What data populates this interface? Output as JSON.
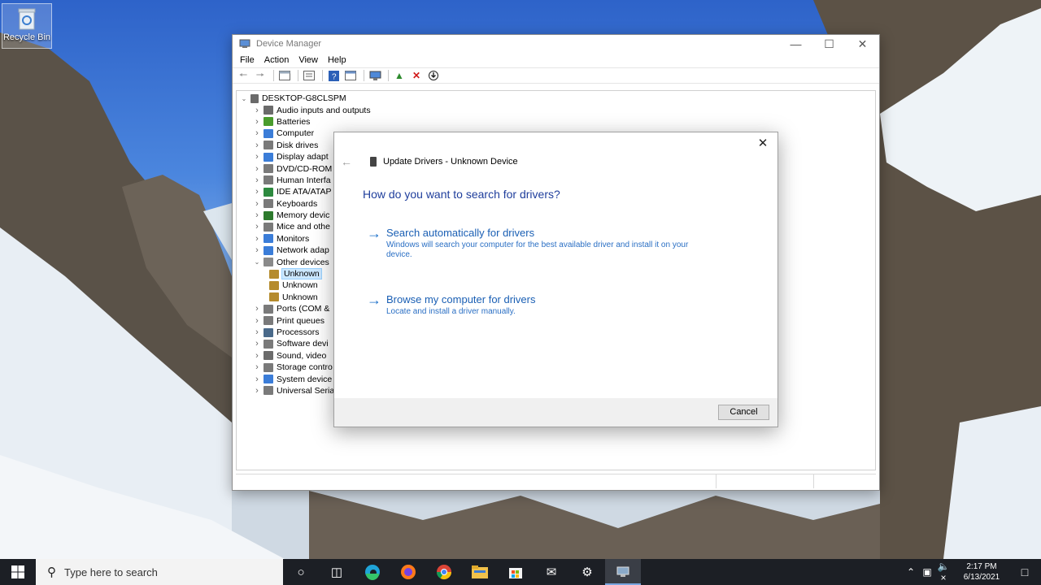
{
  "desktop": {
    "recycle_bin_label": "Recycle Bin"
  },
  "device_manager": {
    "title": "Device Manager",
    "menu": [
      "File",
      "Action",
      "View",
      "Help"
    ],
    "tree": {
      "root": "DESKTOP-G8CLSPM",
      "items": [
        {
          "label": "Audio inputs and outputs",
          "expanded": false,
          "icon_color": "#6b6b6b"
        },
        {
          "label": "Batteries",
          "expanded": false,
          "icon_color": "#4a9c2d"
        },
        {
          "label": "Computer",
          "expanded": false,
          "icon_color": "#3b7dd8"
        },
        {
          "label": "Disk drives",
          "expanded": false,
          "icon_color": "#7a7a7a"
        },
        {
          "label": "Display adapt",
          "expanded": false,
          "icon_color": "#3b7dd8"
        },
        {
          "label": "DVD/CD-ROM",
          "expanded": false,
          "icon_color": "#7a7a7a"
        },
        {
          "label": "Human Interfa",
          "expanded": false,
          "icon_color": "#7a7a7a"
        },
        {
          "label": "IDE ATA/ATAP",
          "expanded": false,
          "icon_color": "#2d8a3f"
        },
        {
          "label": "Keyboards",
          "expanded": false,
          "icon_color": "#7a7a7a"
        },
        {
          "label": "Memory devic",
          "expanded": false,
          "icon_color": "#2d7a2d"
        },
        {
          "label": "Mice and othe",
          "expanded": false,
          "icon_color": "#7a7a7a"
        },
        {
          "label": "Monitors",
          "expanded": false,
          "icon_color": "#3b7dd8"
        },
        {
          "label": "Network adap",
          "expanded": false,
          "icon_color": "#3b7dd8"
        },
        {
          "label": "Other devices",
          "expanded": true,
          "icon_color": "#8a8a8a"
        },
        {
          "label": "Unknown",
          "child": true,
          "selected": true,
          "icon_color": "#b58b2d"
        },
        {
          "label": "Unknown",
          "child": true,
          "icon_color": "#b58b2d"
        },
        {
          "label": "Unknown",
          "child": true,
          "icon_color": "#b58b2d"
        },
        {
          "label": "Ports (COM &",
          "expanded": false,
          "icon_color": "#7a7a7a"
        },
        {
          "label": "Print queues",
          "expanded": false,
          "icon_color": "#7a7a7a"
        },
        {
          "label": "Processors",
          "expanded": false,
          "icon_color": "#4a6a8a"
        },
        {
          "label": "Software devi",
          "expanded": false,
          "icon_color": "#7a7a7a"
        },
        {
          "label": "Sound, video",
          "expanded": false,
          "icon_color": "#6b6b6b"
        },
        {
          "label": "Storage contro",
          "expanded": false,
          "icon_color": "#7a7a7a"
        },
        {
          "label": "System device",
          "expanded": false,
          "icon_color": "#3b7dd8"
        },
        {
          "label": "Universal Seria",
          "expanded": false,
          "icon_color": "#7a7a7a"
        }
      ]
    }
  },
  "dialog": {
    "title": "Update Drivers - Unknown Device",
    "question": "How do you want to search for drivers?",
    "options": [
      {
        "title": "Search automatically for drivers",
        "desc": "Windows will search your computer for the best available driver and install it on your device."
      },
      {
        "title": "Browse my computer for drivers",
        "desc": "Locate and install a driver manually."
      }
    ],
    "cancel_label": "Cancel"
  },
  "taskbar": {
    "search_placeholder": "Type here to search",
    "time": "2:17 PM",
    "date": "6/13/2021"
  }
}
